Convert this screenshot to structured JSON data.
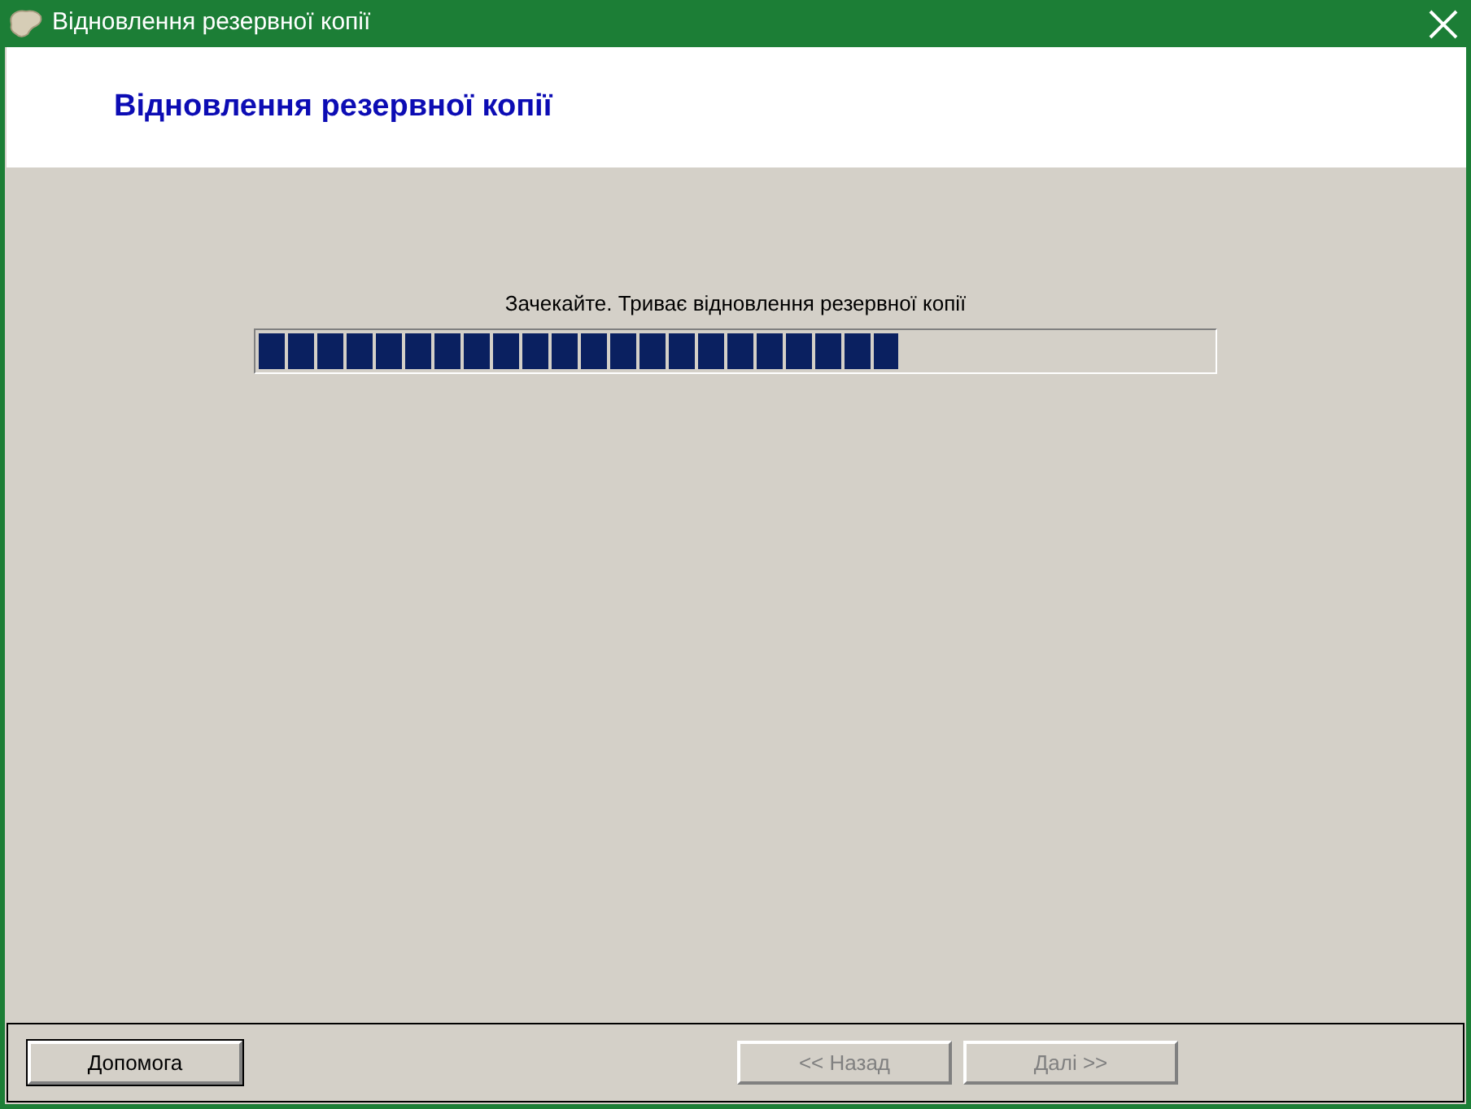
{
  "window": {
    "title": "Відновлення резервної копії"
  },
  "header": {
    "title": "Відновлення резервної копії"
  },
  "progress": {
    "message": "Зачекайте. Триває відновлення резервної копії",
    "level": 0.67
  },
  "buttons": [
    {
      "label": "Допомога",
      "disabled": false,
      "focused": true
    },
    {
      "label": "<< Назад",
      "disabled": true,
      "focused": false
    },
    {
      "label": "Далі >>",
      "disabled": true,
      "focused": false
    }
  ]
}
